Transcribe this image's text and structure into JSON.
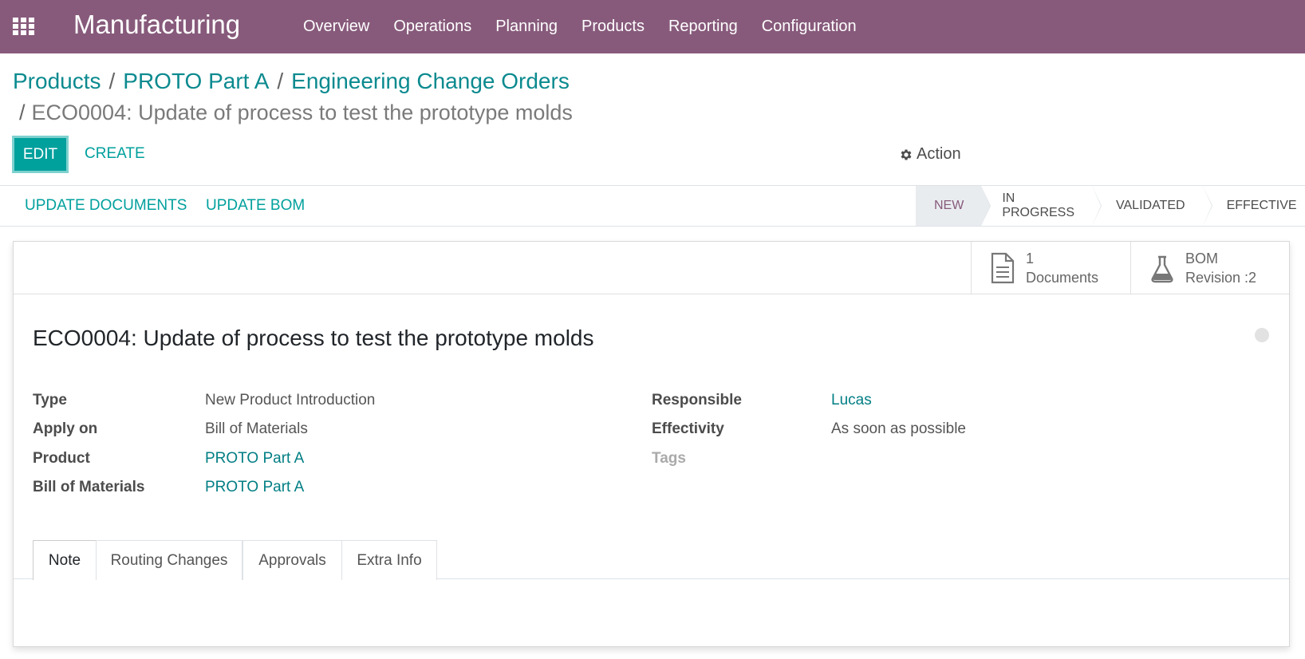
{
  "app": {
    "title": "Manufacturing",
    "menu": [
      "Overview",
      "Operations",
      "Planning",
      "Products",
      "Reporting",
      "Configuration"
    ]
  },
  "breadcrumb": {
    "items": [
      "Products",
      "PROTO Part A",
      "Engineering Change Orders"
    ],
    "current": "ECO0004: Update of process to test the prototype molds"
  },
  "controls": {
    "edit_label": "EDIT",
    "create_label": "CREATE",
    "action_label": "Action"
  },
  "header": {
    "buttons": [
      "UPDATE DOCUMENTS",
      "UPDATE BOM"
    ],
    "stages": [
      "NEW",
      "IN PROGRESS",
      "VALIDATED",
      "EFFECTIVE"
    ],
    "active_stage": "NEW"
  },
  "smart_buttons": [
    {
      "line1": "1",
      "line2": "Documents",
      "icon": "document-icon"
    },
    {
      "line1": "BOM",
      "line2": "Revision :2",
      "icon": "flask-icon"
    }
  ],
  "record": {
    "title": "ECO0004: Update of process to test the prototype molds",
    "left_fields": [
      {
        "label": "Type",
        "value": "New Product Introduction"
      },
      {
        "label": "Apply on",
        "value": "Bill of Materials"
      },
      {
        "label": "Product",
        "value": "PROTO Part A"
      },
      {
        "label": "Bill of Materials",
        "value": "PROTO Part A"
      }
    ],
    "right_fields": [
      {
        "label": "Responsible",
        "value": "Lucas"
      },
      {
        "label": "Effectivity",
        "value": "As soon as possible"
      },
      {
        "label": "Tags",
        "value": ""
      }
    ]
  },
  "tabs": [
    "Note",
    "Routing Changes",
    "Approvals",
    "Extra Info"
  ],
  "colors": {
    "brand": "#875a7b",
    "accent": "#00a09d",
    "link": "#017e84"
  }
}
